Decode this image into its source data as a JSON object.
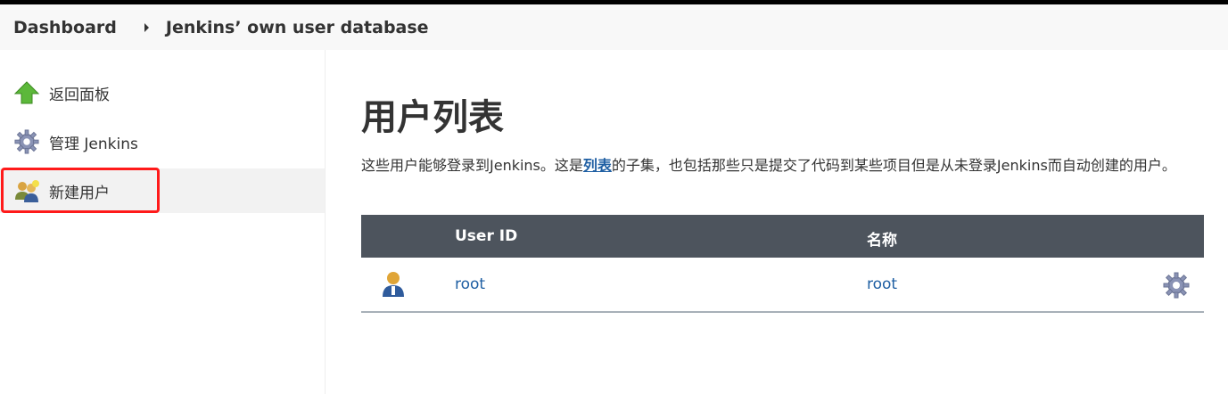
{
  "breadcrumb": {
    "items": [
      "Dashboard",
      "Jenkins’ own user database"
    ]
  },
  "sidebar": {
    "items": [
      {
        "label": "返回面板",
        "icon": "up-arrow-icon"
      },
      {
        "label": "管理 Jenkins",
        "icon": "gear-icon"
      },
      {
        "label": "新建用户",
        "icon": "users-icon"
      }
    ]
  },
  "main": {
    "title": "用户列表",
    "description_before": "这些用户能够登录到Jenkins。这是",
    "description_link": "列表",
    "description_after": "的子集，也包括那些只是提交了代码到某些项目但是从未登录Jenkins而自动创建的用户。",
    "table": {
      "headers": [
        "",
        "User ID",
        "名称",
        ""
      ],
      "rows": [
        {
          "user_id": "root",
          "name": "root"
        }
      ]
    }
  },
  "colors": {
    "table_header_bg": "#4d545d",
    "link": "#1f5fa3",
    "highlight": "#ff1a1a",
    "breadcrumb_bg": "#f8f8f8"
  }
}
